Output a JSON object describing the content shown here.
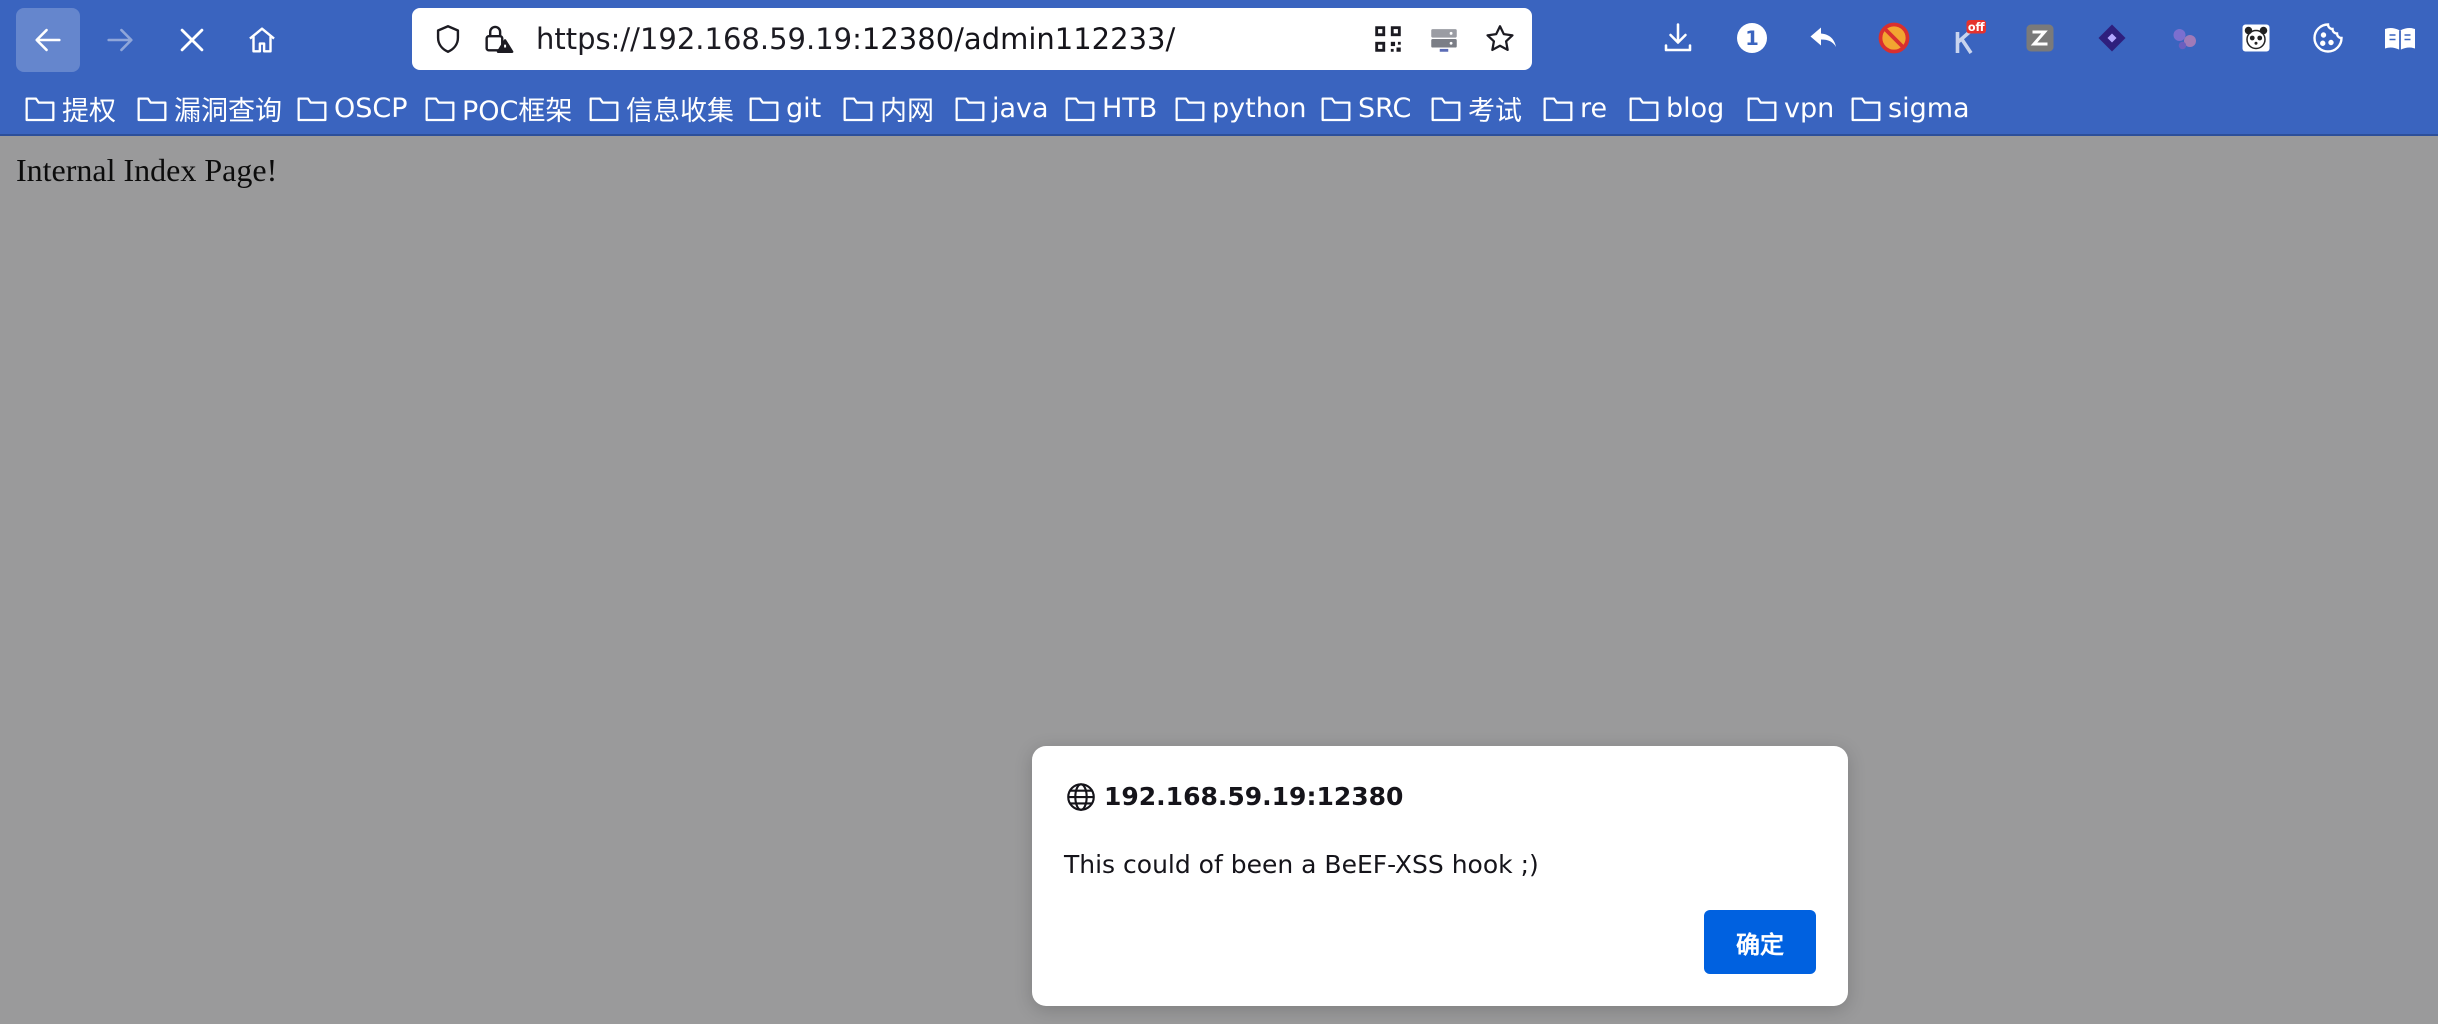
{
  "toolbar": {
    "back_icon": "arrow-left-icon",
    "forward_icon": "arrow-right-icon",
    "stop_icon": "close-icon",
    "home_icon": "home-icon",
    "url_host": "https://192.168.59.19",
    "url_rest": ":12380/admin112233/",
    "extensions": [
      {
        "name": "download-icon"
      },
      {
        "name": "badge-count-icon",
        "label": "1"
      },
      {
        "name": "undo-arrow-icon"
      },
      {
        "name": "blocker-extension-icon"
      },
      {
        "name": "off-extension-icon",
        "label": "off"
      },
      {
        "name": "edit-extension-icon"
      },
      {
        "name": "diamond-extension-icon"
      },
      {
        "name": "dots-extension-icon"
      },
      {
        "name": "panda-extension-icon"
      },
      {
        "name": "cookie-icon"
      },
      {
        "name": "book-icon"
      }
    ]
  },
  "bookmarks": [
    "提权",
    "漏洞查询",
    "OSCP",
    "POC框架",
    "信息收集",
    "git",
    "内网",
    "java",
    "HTB",
    "python",
    "SRC",
    "考试",
    "re",
    "blog",
    "vpn",
    "sigma"
  ],
  "page": {
    "text": "Internal Index Page!"
  },
  "dialog": {
    "origin": "192.168.59.19:12380",
    "message": "This could of been a BeEF-XSS hook ;)",
    "ok_label": "确定"
  },
  "colors": {
    "toolbar_bg": "#3a64bf",
    "page_overlay": "#9a9a9b",
    "dialog_button": "#0061e0"
  }
}
